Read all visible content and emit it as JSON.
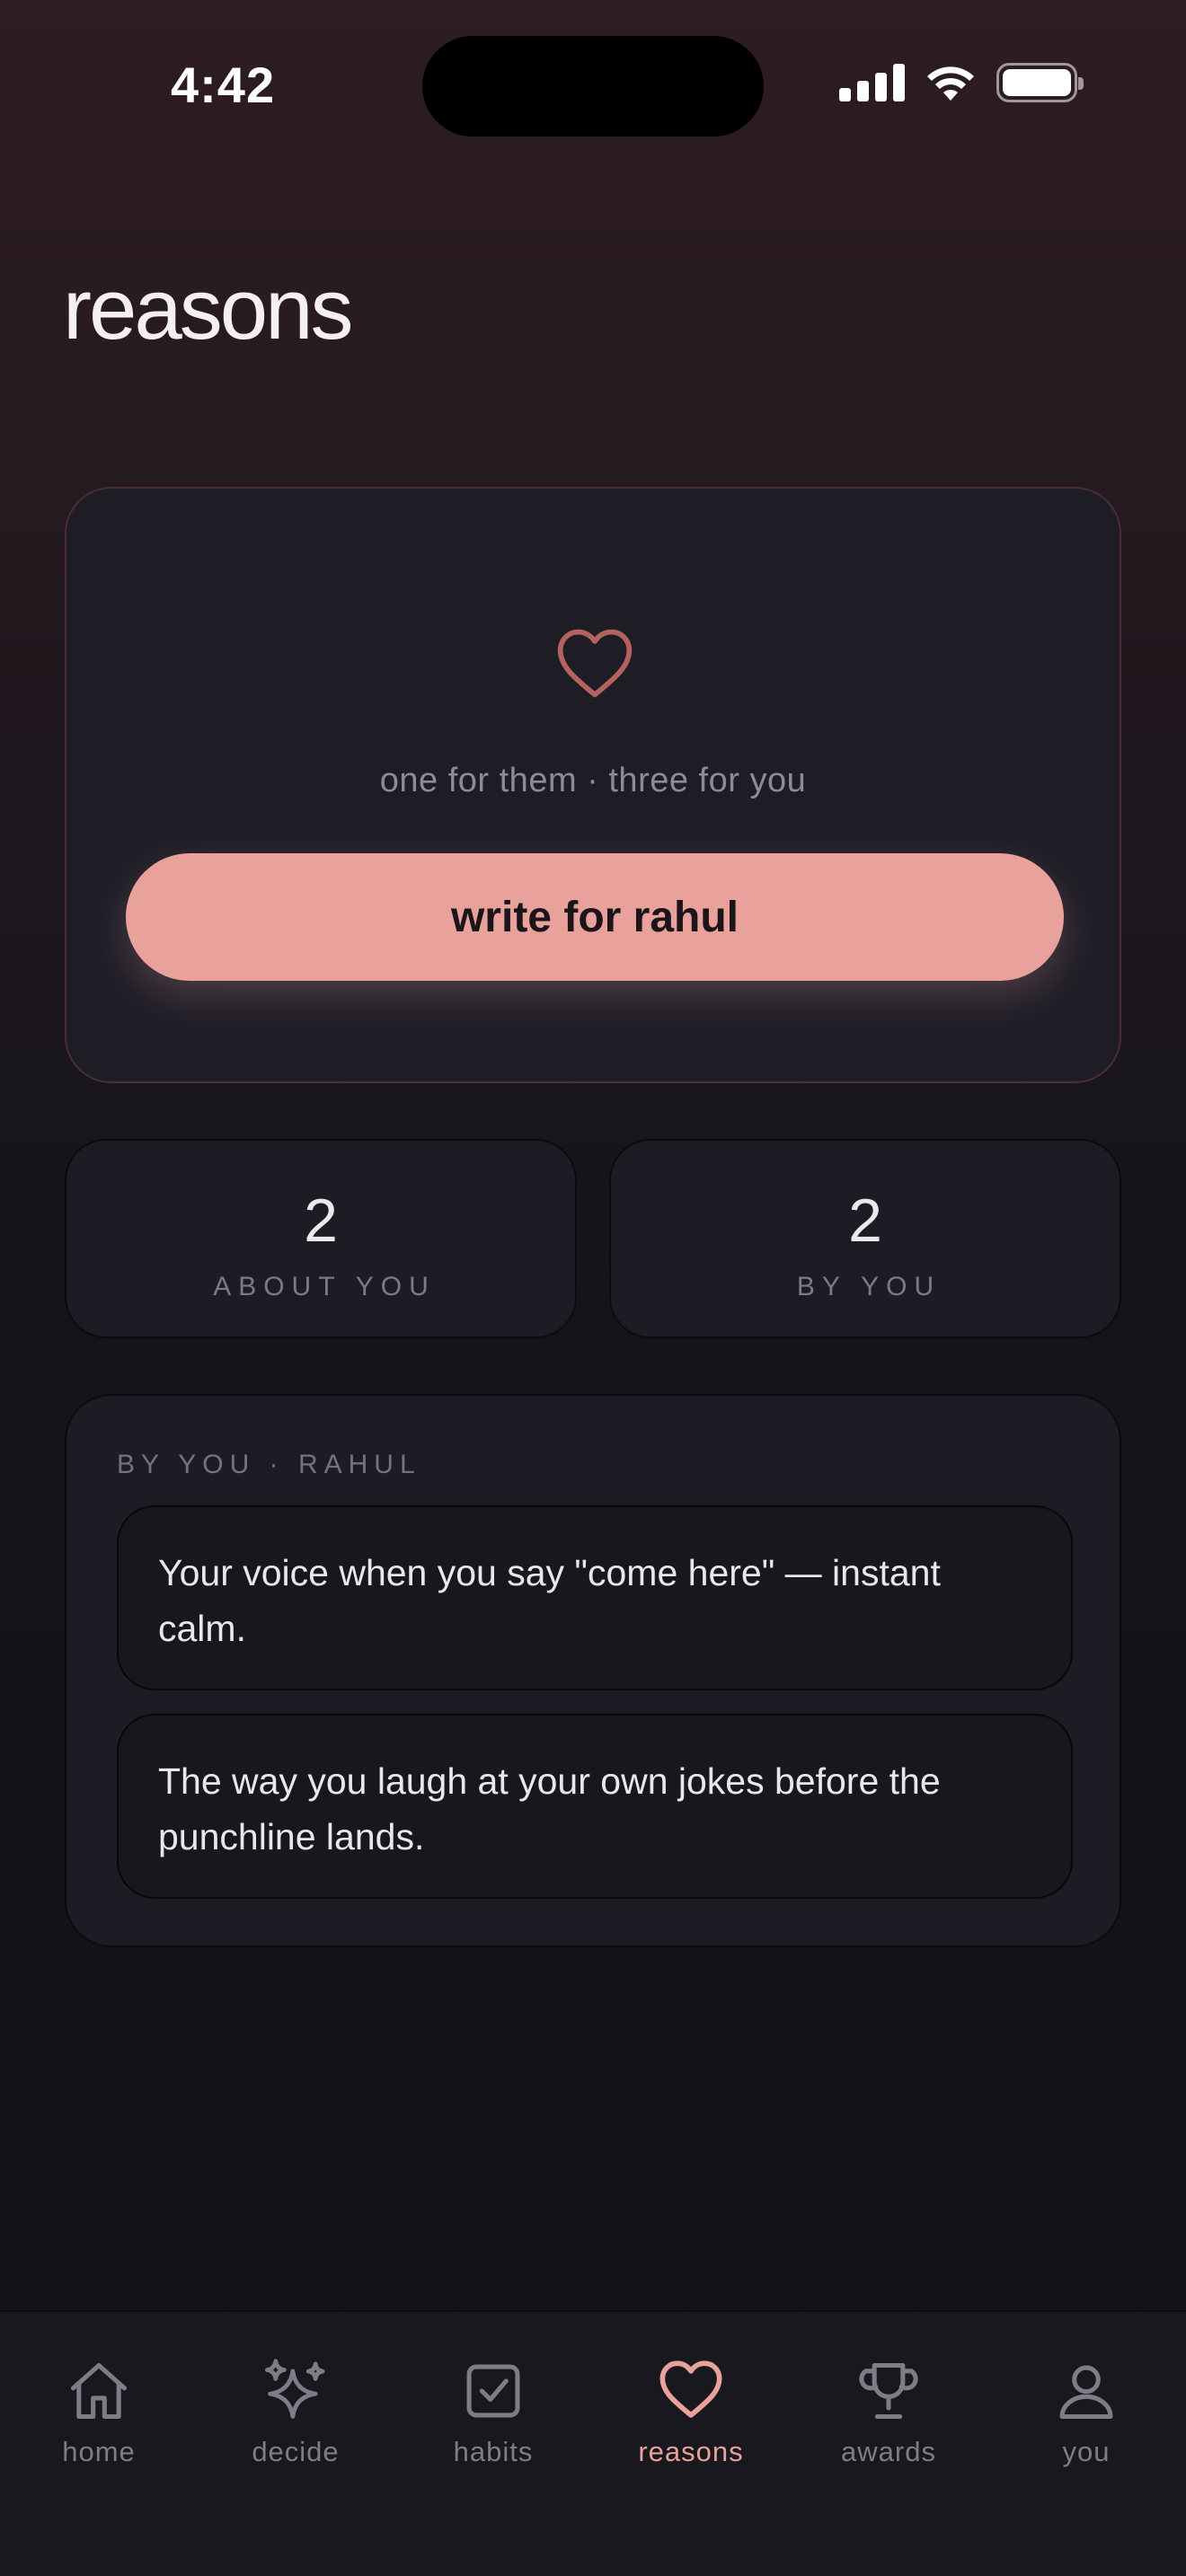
{
  "status_bar": {
    "time": "4:42"
  },
  "title": "reasons",
  "hero": {
    "icon": "heart-outline-icon",
    "subtitle": "one for them · three for you",
    "button_label": "write for rahul"
  },
  "stats": [
    {
      "value": "2",
      "label": "ABOUT YOU"
    },
    {
      "value": "2",
      "label": "BY YOU"
    }
  ],
  "list": {
    "header": "BY YOU · RAHUL",
    "items": [
      {
        "text": "Your voice when you say \"come here\" — instant calm."
      },
      {
        "text": "The way you laugh at your own jokes before the punchline lands."
      }
    ]
  },
  "tabs": [
    {
      "label": "home",
      "icon": "home-icon",
      "active": false
    },
    {
      "label": "decide",
      "icon": "sparkles-icon",
      "active": false
    },
    {
      "label": "habits",
      "icon": "checkbox-icon",
      "active": false
    },
    {
      "label": "reasons",
      "icon": "heart-icon",
      "active": true
    },
    {
      "label": "awards",
      "icon": "trophy-icon",
      "active": false
    },
    {
      "label": "you",
      "icon": "person-icon",
      "active": false
    }
  ],
  "colors": {
    "accent": "#e8a19b",
    "card_background": "#1d1c24",
    "heart_outline": "#b4625f",
    "inactive_tab": "#7f7c88"
  }
}
